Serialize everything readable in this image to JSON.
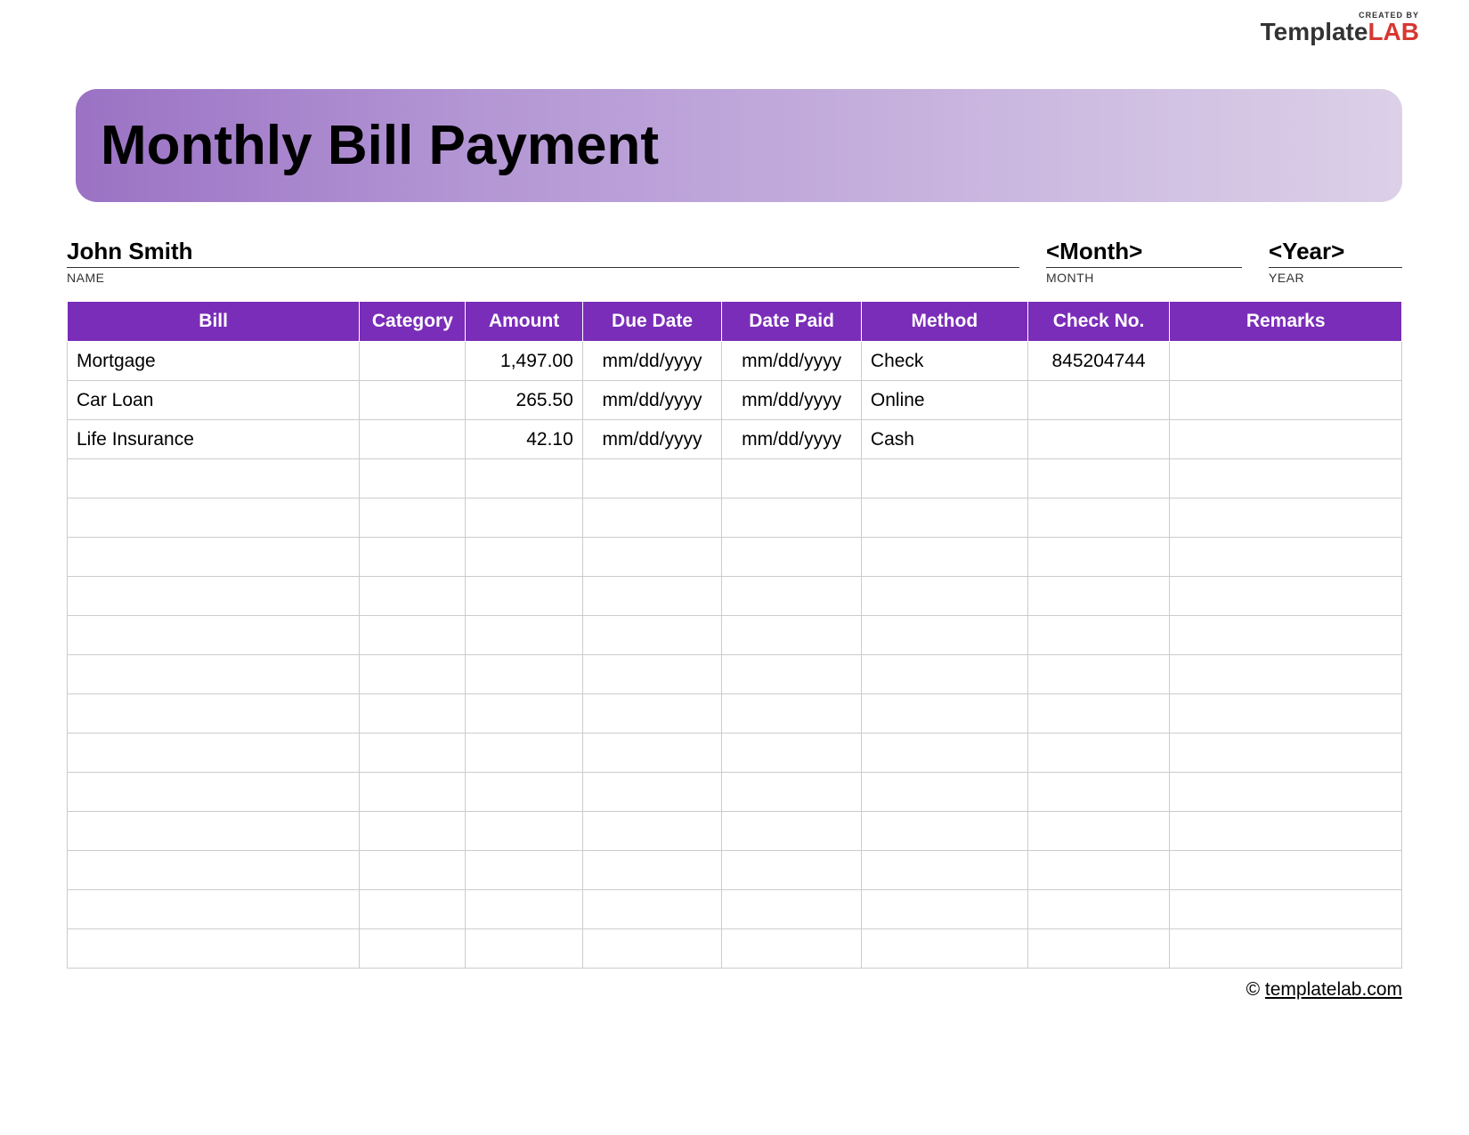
{
  "logo": {
    "created_by": "CREATED BY",
    "template": "Template",
    "lab": "LAB"
  },
  "header": {
    "title": "Monthly Bill Payment"
  },
  "info": {
    "name_value": "John Smith",
    "name_label": "NAME",
    "month_value": "<Month>",
    "month_label": "MONTH",
    "year_value": "<Year>",
    "year_label": "YEAR"
  },
  "table": {
    "headers": {
      "bill": "Bill",
      "category": "Category",
      "amount": "Amount",
      "due_date": "Due Date",
      "date_paid": "Date Paid",
      "method": "Method",
      "check_no": "Check No.",
      "remarks": "Remarks"
    },
    "rows": [
      {
        "bill": "Mortgage",
        "category": "",
        "amount": "1,497.00",
        "due_date": "mm/dd/yyyy",
        "date_paid": "mm/dd/yyyy",
        "method": "Check",
        "check_no": "845204744",
        "remarks": ""
      },
      {
        "bill": "Car Loan",
        "category": "",
        "amount": "265.50",
        "due_date": "mm/dd/yyyy",
        "date_paid": "mm/dd/yyyy",
        "method": "Online",
        "check_no": "",
        "remarks": ""
      },
      {
        "bill": "Life Insurance",
        "category": "",
        "amount": "42.10",
        "due_date": "mm/dd/yyyy",
        "date_paid": "mm/dd/yyyy",
        "method": "Cash",
        "check_no": "",
        "remarks": ""
      },
      {
        "bill": "",
        "category": "",
        "amount": "",
        "due_date": "",
        "date_paid": "",
        "method": "",
        "check_no": "",
        "remarks": ""
      },
      {
        "bill": "",
        "category": "",
        "amount": "",
        "due_date": "",
        "date_paid": "",
        "method": "",
        "check_no": "",
        "remarks": ""
      },
      {
        "bill": "",
        "category": "",
        "amount": "",
        "due_date": "",
        "date_paid": "",
        "method": "",
        "check_no": "",
        "remarks": ""
      },
      {
        "bill": "",
        "category": "",
        "amount": "",
        "due_date": "",
        "date_paid": "",
        "method": "",
        "check_no": "",
        "remarks": ""
      },
      {
        "bill": "",
        "category": "",
        "amount": "",
        "due_date": "",
        "date_paid": "",
        "method": "",
        "check_no": "",
        "remarks": ""
      },
      {
        "bill": "",
        "category": "",
        "amount": "",
        "due_date": "",
        "date_paid": "",
        "method": "",
        "check_no": "",
        "remarks": ""
      },
      {
        "bill": "",
        "category": "",
        "amount": "",
        "due_date": "",
        "date_paid": "",
        "method": "",
        "check_no": "",
        "remarks": ""
      },
      {
        "bill": "",
        "category": "",
        "amount": "",
        "due_date": "",
        "date_paid": "",
        "method": "",
        "check_no": "",
        "remarks": ""
      },
      {
        "bill": "",
        "category": "",
        "amount": "",
        "due_date": "",
        "date_paid": "",
        "method": "",
        "check_no": "",
        "remarks": ""
      },
      {
        "bill": "",
        "category": "",
        "amount": "",
        "due_date": "",
        "date_paid": "",
        "method": "",
        "check_no": "",
        "remarks": ""
      },
      {
        "bill": "",
        "category": "",
        "amount": "",
        "due_date": "",
        "date_paid": "",
        "method": "",
        "check_no": "",
        "remarks": ""
      },
      {
        "bill": "",
        "category": "",
        "amount": "",
        "due_date": "",
        "date_paid": "",
        "method": "",
        "check_no": "",
        "remarks": ""
      },
      {
        "bill": "",
        "category": "",
        "amount": "",
        "due_date": "",
        "date_paid": "",
        "method": "",
        "check_no": "",
        "remarks": ""
      }
    ]
  },
  "footer": {
    "copyright": "©",
    "link": "templatelab.com"
  }
}
